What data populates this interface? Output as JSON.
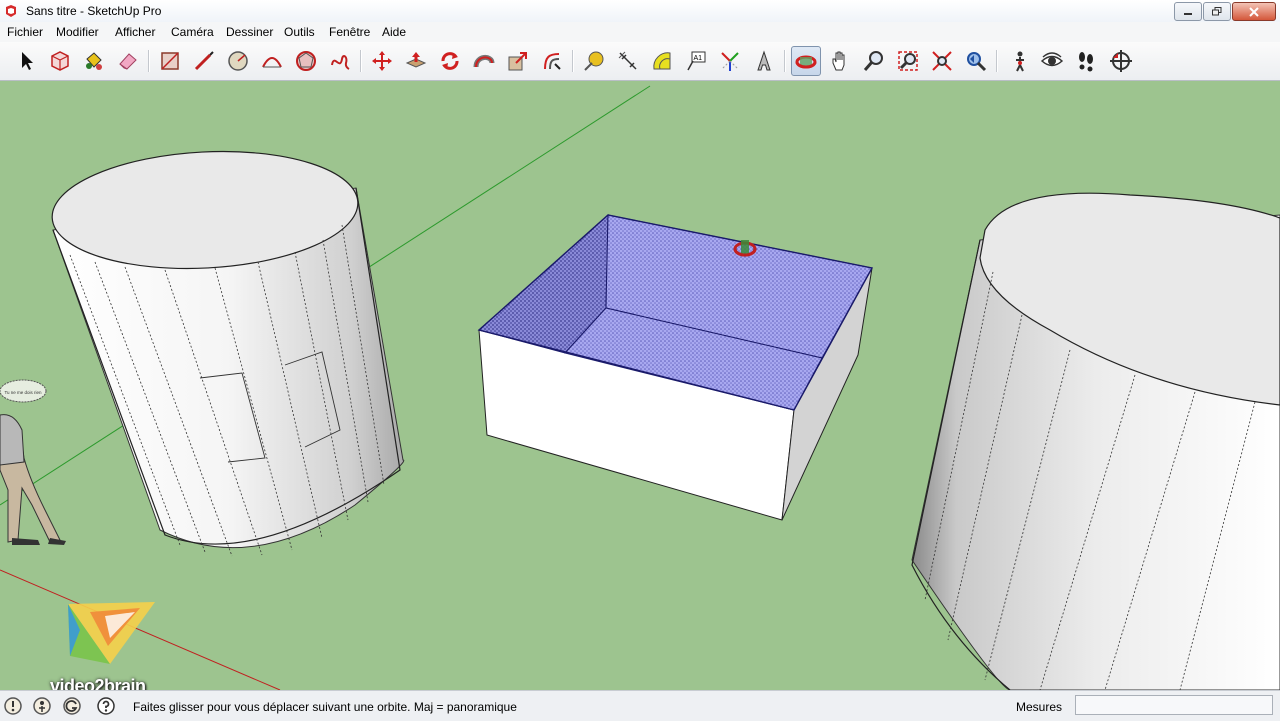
{
  "window": {
    "title": "Sans titre - SketchUp Pro",
    "app_icon": "sketchup-logo-icon",
    "buttons": [
      "minimize-icon",
      "maximize-icon",
      "close-icon"
    ]
  },
  "menu": {
    "items": [
      "Fichier",
      "Modifier",
      "Afficher",
      "Caméra",
      "Dessiner",
      "Outils",
      "Fenêtre",
      "Aide"
    ]
  },
  "toolbar": {
    "tools": [
      {
        "icon": "select-arrow-icon"
      },
      {
        "icon": "make-component-icon"
      },
      {
        "icon": "paint-bucket-icon"
      },
      {
        "icon": "eraser-icon"
      },
      {
        "icon": "rectangle-icon"
      },
      {
        "icon": "line-pencil-icon"
      },
      {
        "icon": "circle-icon"
      },
      {
        "icon": "arc-icon"
      },
      {
        "icon": "polygon-icon"
      },
      {
        "icon": "freehand-icon"
      },
      {
        "icon": "move-icon"
      },
      {
        "icon": "push-pull-icon"
      },
      {
        "icon": "rotate-icon"
      },
      {
        "icon": "follow-me-icon"
      },
      {
        "icon": "scale-icon"
      },
      {
        "icon": "offset-icon"
      },
      {
        "icon": "tape-measure-icon"
      },
      {
        "icon": "dimension-icon"
      },
      {
        "icon": "protractor-icon"
      },
      {
        "icon": "text-label-icon"
      },
      {
        "icon": "axes-icon"
      },
      {
        "icon": "3d-text-icon"
      },
      {
        "icon": "orbit-icon",
        "active": true
      },
      {
        "icon": "pan-hand-icon"
      },
      {
        "icon": "zoom-icon"
      },
      {
        "icon": "zoom-window-icon"
      },
      {
        "icon": "zoom-extents-icon"
      },
      {
        "icon": "previous-view-icon"
      },
      {
        "icon": "position-camera-icon"
      },
      {
        "icon": "look-around-eye-icon"
      },
      {
        "icon": "walk-footprints-icon"
      },
      {
        "icon": "section-plane-icon"
      }
    ]
  },
  "viewport": {
    "background_color": "#9dc48f",
    "cursor": "orbit-cursor-icon",
    "speech_bubble_text": "Tu ne me dois rien",
    "watermark_logo": "video2brain-logo",
    "watermark_text": "video2brain"
  },
  "status": {
    "icons": [
      "geolocation-icon",
      "credits-icon",
      "google-sign-in-icon",
      "help-question-icon"
    ],
    "text": "Faites glisser pour vous déplacer suivant une orbite.  Maj = panoramique",
    "measure_label": "Mesures",
    "measure_value": ""
  },
  "colors": {
    "selection_blue": "#8e8ee6",
    "face_white": "#ffffff",
    "ground": "#9dc48f",
    "axis_green": "#2d9a2d",
    "axis_red": "#c02020"
  }
}
